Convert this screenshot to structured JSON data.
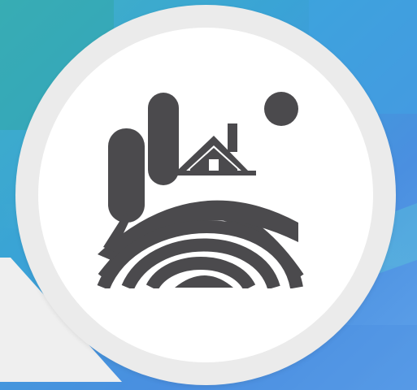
{
  "scene": {
    "background": "blue-sky-abstract",
    "badge": {
      "icon": "countryside-landscape-icon",
      "ring_color": "#ebebeb",
      "face_color": "#ffffff",
      "glyph_color": "#4b4a4d"
    },
    "pointer_color": "#efefef"
  }
}
